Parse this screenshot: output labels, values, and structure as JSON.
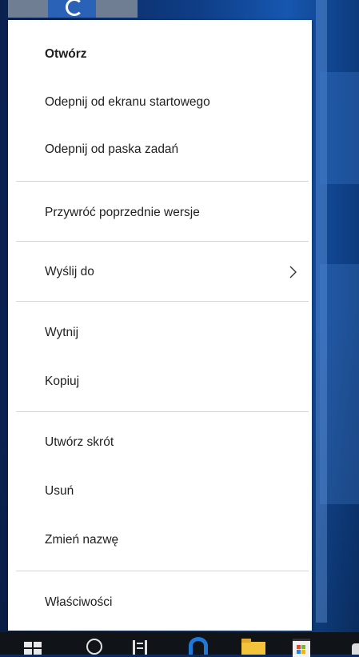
{
  "menu": {
    "items": [
      {
        "label": "Otwórz",
        "bold": true
      },
      {
        "label": "Odepnij od ekranu startowego"
      },
      {
        "label": "Odepnij od paska zadań"
      },
      {
        "label": "Przywróć poprzednie wersje"
      },
      {
        "label": "Wyślij do",
        "submenu": true
      },
      {
        "label": "Wytnij"
      },
      {
        "label": "Kopiuj"
      },
      {
        "label": "Utwórz skrót"
      },
      {
        "label": "Usuń"
      },
      {
        "label": "Zmień nazwę"
      },
      {
        "label": "Właściwości"
      }
    ]
  },
  "taskbar": {
    "icons": [
      "windows-start-icon",
      "search-icon",
      "task-view-icon",
      "edge-browser-icon",
      "file-explorer-icon",
      "store-icon"
    ]
  },
  "colors": {
    "menu_bg": "#ffffff",
    "separator": "#d4d4d4",
    "taskbar": "#101418",
    "desktop": "#0f3d86"
  }
}
